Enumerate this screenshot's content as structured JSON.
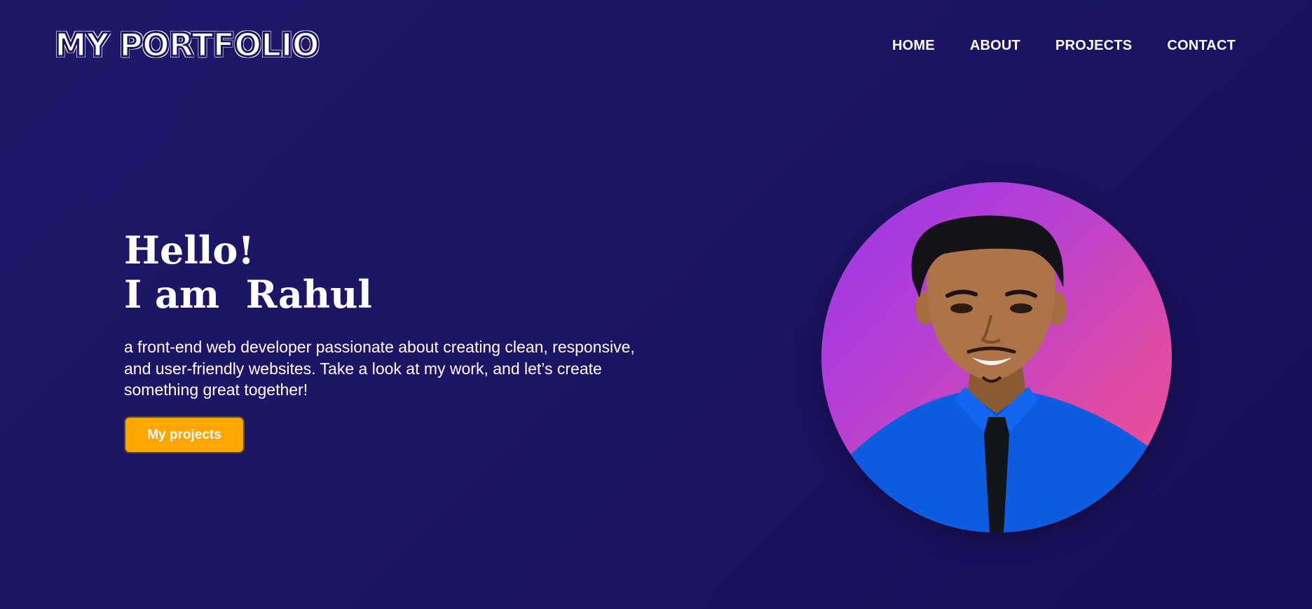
{
  "logo": {
    "text": "MY PORTFOLIO"
  },
  "nav": {
    "items": [
      {
        "label": "HOME"
      },
      {
        "label": "ABOUT"
      },
      {
        "label": "PROJECTS"
      },
      {
        "label": "CONTACT"
      }
    ]
  },
  "hero": {
    "greeting": "Hello!",
    "name_line": "I am  Rahul",
    "description": "a front-end web developer passionate about creating clean, responsive, and user-friendly websites. Take a look at my work, and let’s create something great together!",
    "cta_label": "My projects"
  },
  "colors": {
    "background": "#1b1566",
    "accent": "#ffa500",
    "avatar_gradient_start": "#9a36e6",
    "avatar_gradient_end": "#f0508e"
  }
}
